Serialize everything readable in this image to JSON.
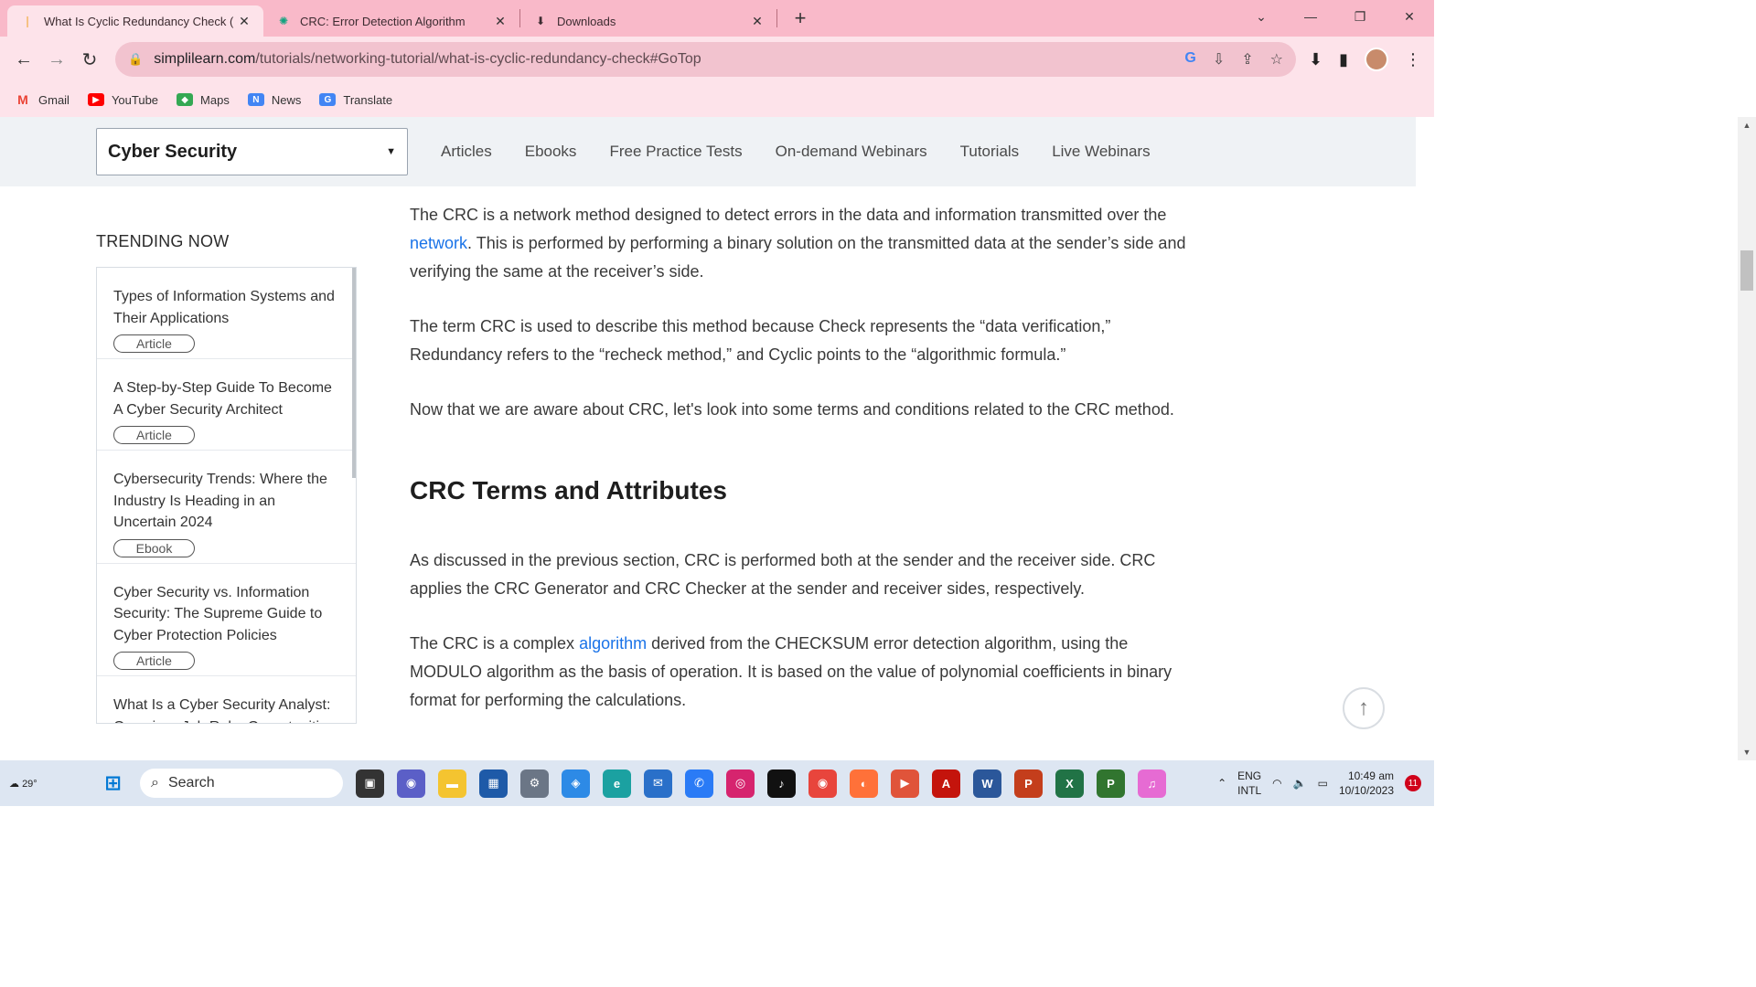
{
  "browser": {
    "tabs": [
      {
        "title": "What Is Cyclic Redundancy Check (",
        "active": true
      },
      {
        "title": "CRC: Error Detection Algorithm",
        "active": false
      },
      {
        "title": "Downloads",
        "active": false
      }
    ],
    "url_host": "simplilearn.com",
    "url_path": "/tutorials/networking-tutorial/what-is-cyclic-redundancy-check#GoTop",
    "bookmarks": [
      "Gmail",
      "YouTube",
      "Maps",
      "News",
      "Translate"
    ]
  },
  "subnav": {
    "category": "Cyber Security",
    "links": [
      "Articles",
      "Ebooks",
      "Free Practice Tests",
      "On-demand Webinars",
      "Tutorials",
      "Live Webinars"
    ]
  },
  "sidebar": {
    "title": "TRENDING NOW",
    "items": [
      {
        "title": "Types of Information Systems and Their Applications",
        "type": "Article"
      },
      {
        "title": "A Step-by-Step Guide To Become A Cyber Security Architect",
        "type": "Article"
      },
      {
        "title": "Cybersecurity Trends: Where the Industry Is Heading in an Uncertain 2024",
        "type": "Ebook"
      },
      {
        "title": "Cyber Security vs. Information Security: The Supreme Guide to Cyber Protection Policies",
        "type": "Article"
      },
      {
        "title": "What Is a Cyber Security Analyst: Overview, Job Role, Opportunities",
        "type": ""
      }
    ]
  },
  "article": {
    "p1_a": "The CRC is a network method designed to detect errors in the data and information transmitted over the ",
    "p1_link": "network",
    "p1_b": ". This is performed by performing a binary solution on the transmitted data at the sender’s side and verifying the same at the receiver’s side.",
    "p2": "The term CRC is used to describe this method because Check represents the “data verification,” Redundancy refers to the “recheck method,” and Cyclic points to the “algorithmic formula.”",
    "p3": "Now that we are aware about CRC, let's look into some terms and conditions related to the CRC method.",
    "h2": "CRC Terms and Attributes",
    "p4": "As discussed in the previous section, CRC is performed both at the sender and the receiver side. CRC applies the CRC Generator and CRC Checker at the sender and receiver sides, respectively.",
    "p5_a": "The CRC is a complex ",
    "p5_link": "algorithm",
    "p5_b": " derived from the CHECKSUM error detection algorithm, using the MODULO algorithm as the basis of operation. It is based on the value of polynomial coefficients in binary format for performing the calculations."
  },
  "taskbar": {
    "weather": "29°",
    "search": "Search",
    "lang_top": "ENG",
    "lang_bottom": "INTL",
    "time": "10:49 am",
    "date": "10/10/2023",
    "notifications": "11"
  }
}
